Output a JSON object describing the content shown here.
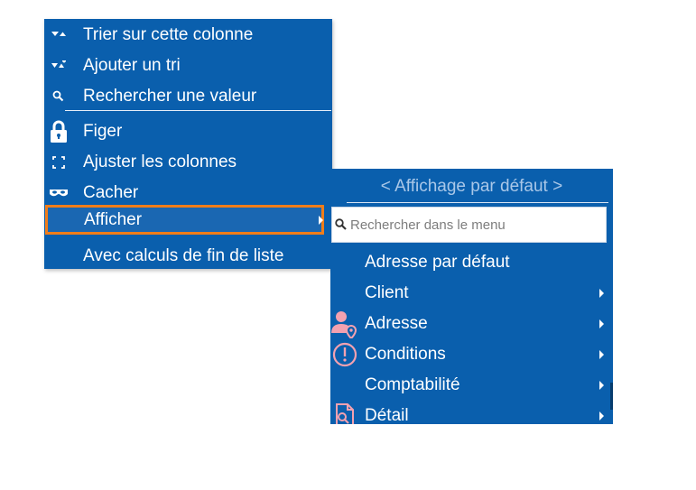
{
  "menu": {
    "items": [
      {
        "label": "Trier sur cette colonne",
        "icon": "sort-icon"
      },
      {
        "label": "Ajouter un tri",
        "icon": "add-sort-icon"
      },
      {
        "label": "Rechercher une valeur",
        "icon": "search-icon"
      },
      {
        "label": "Figer",
        "icon": "lock-icon"
      },
      {
        "label": "Ajuster les colonnes",
        "icon": "fit-columns-icon"
      },
      {
        "label": "Cacher",
        "icon": "mask-icon"
      },
      {
        "label": "Afficher",
        "icon": "",
        "has_submenu": true,
        "selected": true
      },
      {
        "label": "Avec calculs de fin de liste",
        "icon": ""
      }
    ]
  },
  "submenu": {
    "header": "< Affichage par défaut >",
    "search_placeholder": "Rechercher dans le menu",
    "items": [
      {
        "label": "Adresse par défaut",
        "icon": "",
        "has_submenu": false
      },
      {
        "label": "Client",
        "icon": "",
        "has_submenu": true
      },
      {
        "label": "Adresse",
        "icon": "person-location-icon",
        "has_submenu": true
      },
      {
        "label": "Conditions",
        "icon": "exclamation-circle-icon",
        "has_submenu": true
      },
      {
        "label": "Comptabilité",
        "icon": "",
        "has_submenu": true
      },
      {
        "label": "Détail",
        "icon": "document-search-icon",
        "has_submenu": true
      }
    ]
  },
  "colors": {
    "menu_bg": "#0a5fad",
    "highlight_border": "#f07d1a",
    "submenu_icon": "#f3a1b0",
    "header_text": "#a9c7e8"
  }
}
